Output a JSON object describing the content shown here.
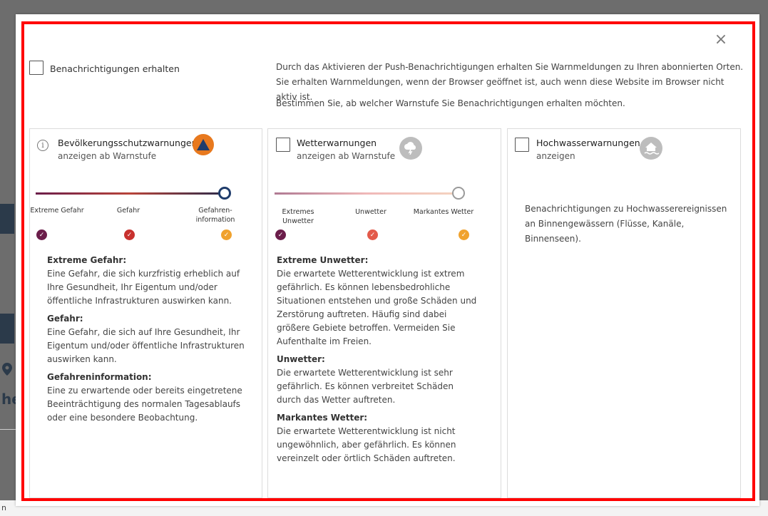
{
  "background": {
    "fragment_text": "he",
    "bottom_text": "n"
  },
  "modal": {
    "close_symbol": "×",
    "main_checkbox_label": "Benachrichtigungen erhalten",
    "intro_paragraphs": [
      "Durch das Aktivieren der Push-Benachrichtigungen erhalten Sie Warnmeldungen zu Ihren abonnierten Orten. Sie erhalten Warnmeldungen, wenn der Browser geöffnet ist, auch wenn diese Website im Browser nicht aktiv ist.",
      "Bestimmen Sie, ab welcher Warnstufe Sie Benachrichtigungen erhalten möchten."
    ]
  },
  "cards": {
    "bevoelkerung": {
      "title": "Bevölkerungsschutzwarnungen",
      "subtitle": "anzeigen ab Warnstufe",
      "info_symbol": "i",
      "slider_level": 1.0,
      "ticks": [
        "Extreme Gefahr",
        "Gefahr",
        "Gefahren-\ninformation"
      ],
      "descriptions": [
        {
          "heading": "Extreme Gefahr:",
          "text": "Eine Gefahr, die sich kurzfristig erheblich auf Ihre Gesundheit, Ihr Eigentum und/oder öffentliche Infrastrukturen auswirken kann."
        },
        {
          "heading": "Gefahr:",
          "text": "Eine Gefahr, die sich auf Ihre Gesundheit, Ihr Eigentum und/oder öffentliche Infrastrukturen auswirken kann."
        },
        {
          "heading": "Gefahreninformation:",
          "text": "Eine zu erwartende oder bereits eingetretene Beeinträchtigung des normalen Tagesablaufs oder eine besondere Beobachtung."
        }
      ]
    },
    "wetter": {
      "title": "Wetterwarnungen",
      "subtitle": "anzeigen ab Warnstufe",
      "slider_level": 1.0,
      "ticks": [
        "Extremes Unwetter",
        "Unwetter",
        "Markantes Wetter"
      ],
      "descriptions": [
        {
          "heading": "Extreme Unwetter:",
          "text": "Die erwartete Wetterentwicklung ist extrem gefährlich. Es können lebensbedrohliche Situationen entstehen und große Schäden und Zerstörung auftreten. Häufig sind dabei größere Gebiete betroffen. Vermeiden Sie Aufenthalte im Freien."
        },
        {
          "heading": "Unwetter:",
          "text": "Die erwartete Wetterentwicklung ist sehr gefährlich. Es können verbreitet Schäden durch das Wetter auftreten."
        },
        {
          "heading": "Markantes Wetter:",
          "text": "Die erwartete Wetterentwicklung ist nicht ungewöhnlich, aber gefährlich. Es können vereinzelt oder örtlich Schäden auftreten."
        }
      ]
    },
    "hochwasser": {
      "title": "Hochwasserwarnungen",
      "subtitle": "anzeigen",
      "text": "Benachrichtigungen zu Hochwasserereignissen an Binnengewässern (Flüsse, Kanäle, Binnenseen)."
    }
  },
  "colors": {
    "extreme": "#6b1d4a",
    "danger": "#c8312e",
    "info": "#f0a22e",
    "bevoelkerung_badge": "#e8791e",
    "bevoelkerung_triangle": "#1f3c6b",
    "weather_badge": "#bdbdbd",
    "slider_knob_dark": "#1f3c6b",
    "slider_knob_light": "#9a9a9a",
    "highlight_border": "#ff0000"
  }
}
